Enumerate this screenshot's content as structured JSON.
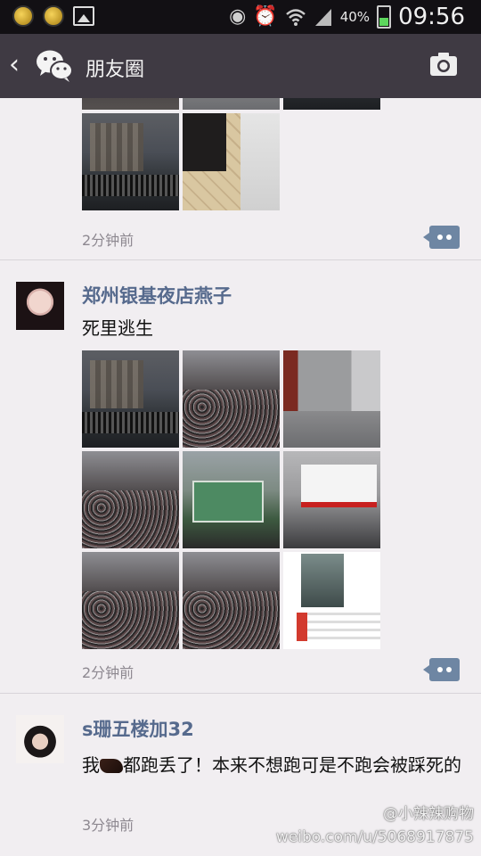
{
  "status_bar": {
    "battery": "40%",
    "time": "09:56",
    "icons": [
      "notification-icon",
      "notification-icon",
      "image-icon",
      "eye-icon",
      "alarm-icon",
      "wifi-icon",
      "signal-icon",
      "battery-icon"
    ]
  },
  "nav": {
    "back_icon": "chevron-left-icon",
    "logo_icon": "wechat-logo-icon",
    "title": "朋友圈",
    "action_icon": "camera-icon"
  },
  "posts": [
    {
      "time": "2分钟前",
      "comment_icon": "comment-icon"
    },
    {
      "author": "郑州银基夜店燕子",
      "text": "死里逃生",
      "time": "2分钟前",
      "comment_icon": "comment-icon"
    },
    {
      "author": "s珊五楼加32",
      "text_before": "我",
      "text_after": "都跑丢了！本来不想跑可是不跑会被踩死的",
      "time": "3分钟前"
    }
  ],
  "watermark": {
    "handle": "@小辣辣购物",
    "url": "weibo.com/u/5068917875"
  }
}
